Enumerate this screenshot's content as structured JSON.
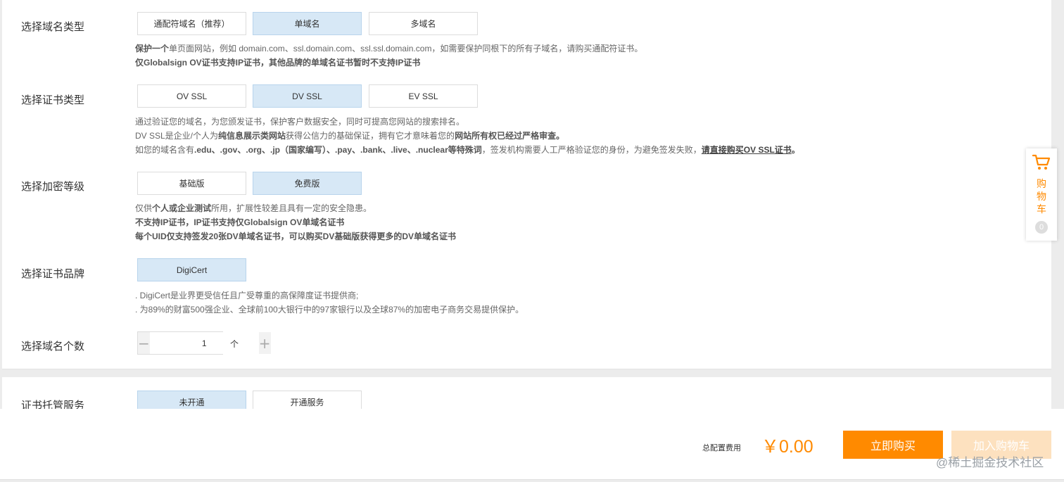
{
  "sections": {
    "domain_type": {
      "label": "选择域名类型",
      "options": [
        "通配符域名（推荐）",
        "单域名",
        "多域名"
      ],
      "desc": {
        "l1_bold": "保护一个",
        "l1_rest": "单页面网站，例如 domain.com、ssl.domain.com、ssl.ssl.domain.com，如需要保护同根下的所有子域名，请购买通配符证书。",
        "l2": "仅Globalsign OV证书支持IP证书，其他品牌的单域名证书暂时不支持IP证书"
      }
    },
    "cert_type": {
      "label": "选择证书类型",
      "options": [
        "OV SSL",
        "DV SSL",
        "EV SSL"
      ],
      "desc": {
        "l1": "通过验证您的域名，为您颁发证书，保护客户数据安全，同时可提高您网站的搜索排名。",
        "l2_a": "DV SSL是企业/个人为",
        "l2_b": "纯信息展示类网站",
        "l2_c": "获得公信力的基础保证，拥有它才意味着您的",
        "l2_d": "网站所有权已经过严格审查。",
        "l3_a": "如您的域名含有",
        "l3_b": ".edu、.gov、.org、.jp（国家编写）、.pay、.bank、.live、.nuclear等特殊词",
        "l3_c": "，签发机构需要人工严格验证您的身份，为避免签发失败，",
        "l3_d": "请直接购买OV SSL证书",
        "l3_e": "。"
      }
    },
    "encrypt_level": {
      "label": "选择加密等级",
      "options": [
        "基础版",
        "免费版"
      ],
      "desc": {
        "l1_a": "仅供",
        "l1_b": "个人或企业测试",
        "l1_c": "所用，扩展性较差且具有一定的安全隐患。",
        "l2": "不支持IP证书，IP证书支持仅Globalsign OV单域名证书",
        "l3": "每个UID仅支持签发20张DV单域名证书，可以购买DV基础版获得更多的DV单域名证书"
      }
    },
    "brand": {
      "label": "选择证书品牌",
      "options": [
        "DigiCert"
      ],
      "desc": {
        "l1": ". DigiCert是业界更受信任且广受尊重的高保障度证书提供商;",
        "l2": ". 为89%的财富500强企业、全球前100大银行中的97家银行以及全球87%的加密电子商务交易提供保护。"
      }
    },
    "domain_count": {
      "label": "选择域名个数",
      "value": "1",
      "unit": "个",
      "minus": "−",
      "plus": "+"
    },
    "hosting": {
      "label": "证书托管服务",
      "options": [
        "未开通",
        "开通服务"
      ]
    }
  },
  "footer": {
    "total_label": "总配置费用",
    "total_price": "￥0.00",
    "buy_label": "立即购买",
    "add_cart_label": "加入购物车",
    "watermark": "@稀土掘金技术社区"
  },
  "float_cart": {
    "label": "购物车",
    "count": "0",
    "icon": "cart-icon"
  },
  "colors": {
    "accent": "#ff8a00",
    "selected_bg": "#d7e8f6",
    "cart_disabled": "#fde1bf"
  }
}
